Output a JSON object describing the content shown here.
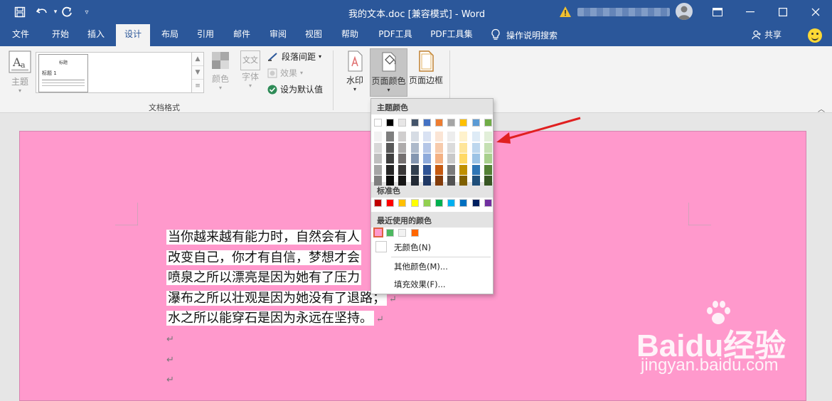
{
  "titlebar": {
    "title": "我的文本.doc [兼容模式]  -  Word",
    "warning_icon": "warning-icon",
    "bg_color": "#2b579a"
  },
  "tabs": [
    "文件",
    "开始",
    "插入",
    "设计",
    "布局",
    "引用",
    "邮件",
    "审阅",
    "视图",
    "帮助",
    "PDF工具",
    "PDF工具集"
  ],
  "active_tab": "设计",
  "tell_me": "操作说明搜索",
  "share": "共享",
  "ribbon": {
    "theme": "主题",
    "gallery_title": "标题",
    "gallery_heading": "标题 1",
    "colors": "颜色",
    "fonts": "字体",
    "fonts_icon_text": "文文",
    "paragraph_spacing": "段落间距",
    "effects": "效果",
    "set_default": "设为默认值",
    "group_doc_format": "文档格式",
    "watermark": "水印",
    "page_color": "页面颜色",
    "page_borders": "页面边框"
  },
  "dropdown": {
    "theme_colors_label": "主题颜色",
    "standard_colors_label": "标准色",
    "recent_colors_label": "最近使用的颜色",
    "no_color": "无颜色(N)",
    "more_colors": "其他颜色(M)...",
    "fill_effects": "填充效果(F)...",
    "theme_top_row": [
      "#ffffff",
      "#000000",
      "#e7e6e6",
      "#44546a",
      "#4472c4",
      "#ed7d31",
      "#a5a5a5",
      "#ffc000",
      "#5b9bd5",
      "#70ad47"
    ],
    "theme_shades": [
      [
        "#f2f2f2",
        "#d8d8d8",
        "#bfbfbf",
        "#a5a5a5",
        "#7f7f7f"
      ],
      [
        "#7f7f7f",
        "#595959",
        "#3f3f3f",
        "#262626",
        "#0c0c0c"
      ],
      [
        "#d0cece",
        "#aeabab",
        "#757070",
        "#3a3838",
        "#171616"
      ],
      [
        "#d6dce4",
        "#adb9ca",
        "#8496b0",
        "#323f4f",
        "#222a35"
      ],
      [
        "#d9e2f3",
        "#b4c6e7",
        "#8eaadb",
        "#2f5496",
        "#1f3864"
      ],
      [
        "#fbe5d5",
        "#f7cbac",
        "#f4b183",
        "#c55a11",
        "#833c0b"
      ],
      [
        "#ededed",
        "#dbdbdb",
        "#c9c9c9",
        "#7b7b7b",
        "#525252"
      ],
      [
        "#fff2cc",
        "#fee599",
        "#ffd965",
        "#bf9000",
        "#7f6000"
      ],
      [
        "#deebf6",
        "#bdd7ee",
        "#9cc3e5",
        "#2e75b5",
        "#1e4e79"
      ],
      [
        "#e2efd9",
        "#c5e0b3",
        "#a8d08d",
        "#538135",
        "#375623"
      ]
    ],
    "standard": [
      "#c00000",
      "#ff0000",
      "#ffc000",
      "#ffff00",
      "#92d050",
      "#00b050",
      "#00b0f0",
      "#0070c0",
      "#002060",
      "#7030a0"
    ],
    "recent": [
      "#ff99cc",
      "#4cb860",
      "#f2f2f2",
      "#ff6600"
    ]
  },
  "document": {
    "page_color": "#ff99cc",
    "lines": [
      "当你越来越有能力时，自然会有人",
      "改变自己，你才有自信，梦想才会",
      "喷泉之所以漂亮是因为她有了压力",
      "瀑布之所以壮观是因为她没有了退路；",
      "水之所以能穿石是因为永远在坚持。"
    ],
    "para_mark": "↵"
  },
  "watermark": {
    "brand": "Bai",
    "brand_suffix": "du经验",
    "url": "jingyan.baidu.com"
  }
}
